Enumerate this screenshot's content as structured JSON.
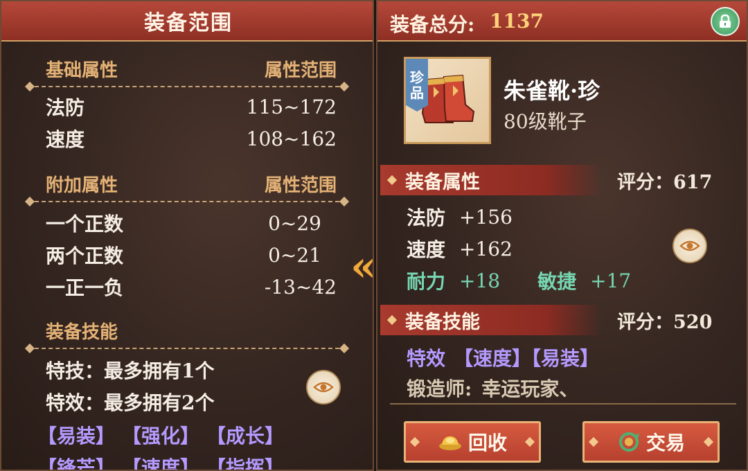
{
  "left": {
    "title": "装备范围",
    "base_header": {
      "label": "基础属性",
      "range_label": "属性范围"
    },
    "base_rows": [
      {
        "name": "法防",
        "value": "115~172"
      },
      {
        "name": "速度",
        "value": "108~162"
      }
    ],
    "extra_header": {
      "label": "附加属性",
      "range_label": "属性范围"
    },
    "extra_rows": [
      {
        "name": "一个正数",
        "value": "0~29"
      },
      {
        "name": "两个正数",
        "value": "0~21"
      },
      {
        "name": "一正一负",
        "value": "-13~42"
      }
    ],
    "skill_header": "装备技能",
    "skill_lines": [
      "特技：最多拥有1个",
      "特效：最多拥有2个"
    ],
    "tags_row1": [
      "【易装】",
      "【强化】",
      "【成长】"
    ],
    "tags_row2": [
      "【锋芒】",
      "【速度】",
      "【指挥】"
    ]
  },
  "right": {
    "score_label": "装备总分:",
    "score_value": "1137",
    "lock_icon": "lock-icon",
    "item": {
      "rarity": "珍品",
      "rarity_char1": "珍",
      "rarity_char2": "品",
      "name": "朱雀靴·珍",
      "type": "80级靴子"
    },
    "attr_section": {
      "title": "装备属性",
      "score": "评分：617"
    },
    "attrs": [
      {
        "name": "法防",
        "value": "+156"
      },
      {
        "name": "速度",
        "value": "+162"
      }
    ],
    "green_attrs": [
      {
        "name": "耐力",
        "value": "+18"
      },
      {
        "name": "敏捷",
        "value": "+17"
      }
    ],
    "skill_section": {
      "title": "装备技能",
      "score": "评分：520"
    },
    "effect_label": "特效",
    "effects": "【速度】【易装】",
    "smith_label": "锻造师:",
    "smith_name": "幸运玩家、",
    "buttons": {
      "recycle": "回收",
      "trade": "交易"
    }
  },
  "colors": {
    "header_red": "#a83a2e",
    "gold_text": "#e4b276",
    "score_gold": "#ffd27a",
    "purple_tag": "#b49aff",
    "green_attr": "#76d6b2",
    "rarity_blue": "#5c89b8"
  }
}
